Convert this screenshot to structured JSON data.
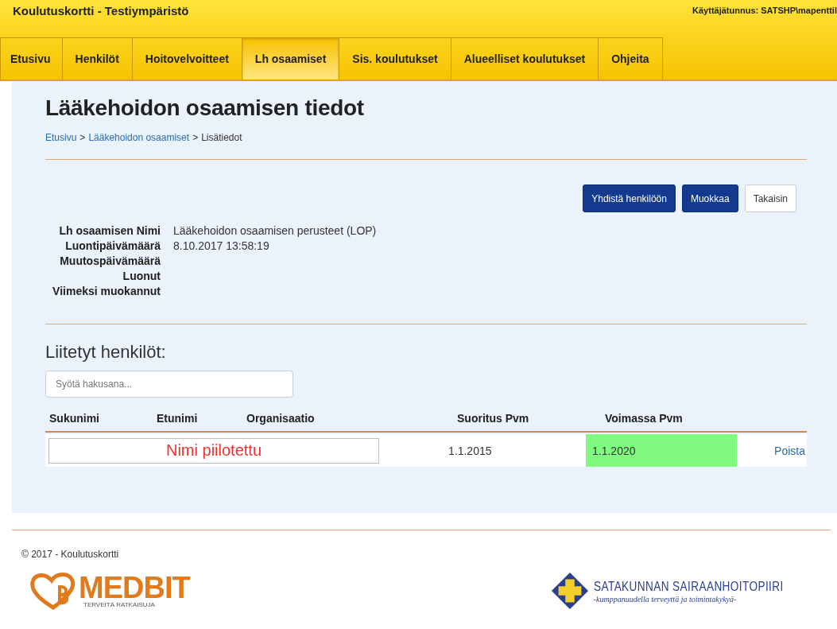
{
  "header": {
    "title": "Koulutuskortti - Testiympäristö",
    "user": "Käyttäjätunnus: SATSHP\\mapenttil"
  },
  "nav": [
    {
      "label": "Etusivu",
      "selected": false
    },
    {
      "label": "Henkilöt",
      "selected": false
    },
    {
      "label": "Hoitovelvoitteet",
      "selected": false
    },
    {
      "label": "Lh osaamiset",
      "selected": true
    },
    {
      "label": "Sis. koulutukset",
      "selected": false
    },
    {
      "label": "Alueelliset koulutukset",
      "selected": false
    },
    {
      "label": "Ohjeita",
      "selected": false
    }
  ],
  "page_title": "Lääkehoidon osaamisen tiedot",
  "breadcrumb": [
    {
      "label": "Etusivu",
      "kind": "link"
    },
    {
      "label": ">",
      "kind": "separator"
    },
    {
      "label": "Lääkehoidon osaamiset",
      "kind": "link"
    },
    {
      "label": ">",
      "kind": "separator"
    },
    {
      "label": "Lisätiedot",
      "kind": "current"
    }
  ],
  "actions": [
    {
      "label": "Yhdistä henkilöön",
      "kind": "primary"
    },
    {
      "label": "Muokkaa",
      "kind": "primary"
    },
    {
      "label": "Takaisin",
      "kind": "default"
    }
  ],
  "details": [
    {
      "label": "Lh osaamisen Nimi",
      "value": "Lääkehoidon osaamisen perusteet (LOP)"
    },
    {
      "label": "Luontipäivämäärä",
      "value": "8.10.2017 13:58:19"
    },
    {
      "label": "Muutospäivämäärä"
    },
    {
      "label": "Luonut"
    },
    {
      "label": "Viimeksi muokannut"
    }
  ],
  "persons": {
    "heading": "Liitetyt henkilöt:",
    "search": {
      "placeholder": "Syötä hakusana..."
    },
    "columns": [
      "Sukunimi",
      "Etunimi",
      "Organisaatio",
      "Suoritus Pvm",
      "Voimassa Pvm"
    ],
    "rows": [
      {
        "hidden_name": "Nimi piilotettu",
        "completed": "1.1.2015",
        "valid_until": "1.1.2020",
        "valid": true,
        "action": "Poista"
      }
    ]
  },
  "footer": {
    "copyright": "© 2017 - Koulutuskortti",
    "logo_left": {
      "name": "MEDBIT",
      "tagline": "TERVEITÄ RATKAISUJA"
    },
    "logo_right": {
      "name": "SATAKUNNAN SAIRAANHOITOPIIRI",
      "tagline": "-kumppanuudella terveyttä ja toimintakykyä-"
    }
  }
}
